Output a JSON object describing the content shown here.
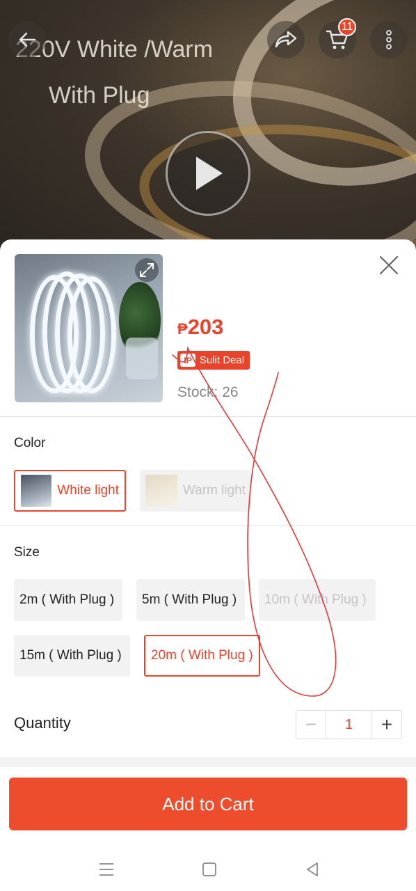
{
  "hero": {
    "title_line1": "220V White /Warm",
    "title_line2": "With Plug",
    "cart_count": "11"
  },
  "product": {
    "currency": "₱",
    "price": "203",
    "deal_badge": "Sulit Deal",
    "deal_icon_text": "IP",
    "stock": "Stock: 26"
  },
  "color": {
    "label": "Color",
    "options": [
      {
        "label": "White light",
        "state": "selected"
      },
      {
        "label": "Warm light",
        "state": "disabled"
      }
    ]
  },
  "size": {
    "label": "Size",
    "options": [
      {
        "label": "2m ( With Plug )",
        "state": "normal"
      },
      {
        "label": "5m ( With Plug )",
        "state": "normal"
      },
      {
        "label": "10m ( With Plug )",
        "state": "disabled"
      },
      {
        "label": "15m ( With Plug )",
        "state": "normal"
      },
      {
        "label": "20m ( With Plug )",
        "state": "selected"
      }
    ]
  },
  "quantity": {
    "label": "Quantity",
    "value": "1",
    "minus": "−",
    "plus": "+"
  },
  "actions": {
    "add_to_cart": "Add to Cart"
  },
  "colors": {
    "accent": "#ee4d2d",
    "price": "#e8442b"
  }
}
